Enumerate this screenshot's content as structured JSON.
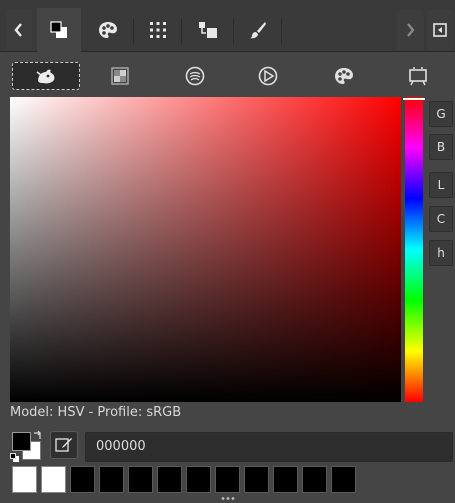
{
  "tabs": [
    {
      "id": "fg-bg-colors",
      "icon": "fg-bg-colors-icon",
      "active": true
    },
    {
      "id": "palettes",
      "icon": "palette-icon",
      "active": false
    },
    {
      "id": "selection",
      "icon": "selection-grid-icon",
      "active": false
    },
    {
      "id": "pointer",
      "icon": "pointer-icon",
      "active": false
    },
    {
      "id": "brushes",
      "icon": "brush-icon",
      "active": false
    }
  ],
  "selectors": [
    {
      "id": "gimp",
      "icon": "wilber-icon",
      "active": true
    },
    {
      "id": "cmyk",
      "icon": "cmyk-icon",
      "active": false
    },
    {
      "id": "watercolor",
      "icon": "watercolor-icon",
      "active": false
    },
    {
      "id": "wheel",
      "icon": "wheel-icon",
      "active": false
    },
    {
      "id": "palette",
      "icon": "palette-icon",
      "active": false
    },
    {
      "id": "scales",
      "icon": "scales-icon",
      "active": false
    }
  ],
  "channels": [
    "G",
    "B",
    "L",
    "C",
    "h"
  ],
  "model_label": "Model: HSV - Profile: sRGB",
  "hex_value": "000000",
  "colors": {
    "foreground": "#000000",
    "background": "#ffffff",
    "hue": "#ff0000"
  },
  "history": [
    "#ffffff",
    "#ffffff",
    "#000000",
    "#000000",
    "#000000",
    "#000000",
    "#000000",
    "#000000",
    "#000000",
    "#000000",
    "#000000",
    "#000000"
  ]
}
